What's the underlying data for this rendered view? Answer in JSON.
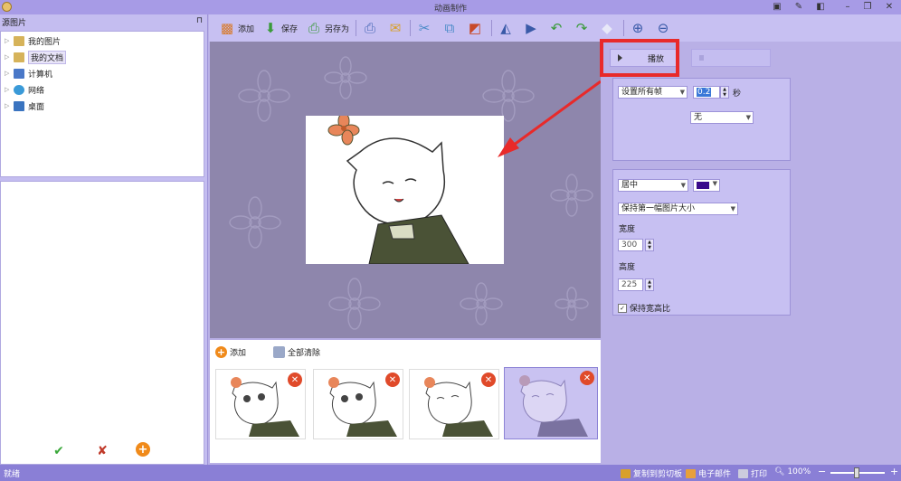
{
  "title_bar": {
    "title": "动画制作",
    "buttons": [
      "minimize",
      "restore",
      "close"
    ]
  },
  "left_panel": {
    "header": "源图片",
    "tree": [
      {
        "label": "我的图片",
        "icon": "folder-pictures-icon",
        "color": "#d6b35a"
      },
      {
        "label": "我的文档",
        "icon": "folder-documents-icon",
        "color": "#d6b35a"
      },
      {
        "label": "计算机",
        "icon": "computer-icon",
        "color": "#4a78c8"
      },
      {
        "label": "网络",
        "icon": "network-icon",
        "color": "#3a9ad8"
      },
      {
        "label": "桌面",
        "icon": "desktop-icon",
        "color": "#3a74c0"
      }
    ],
    "bottom_icons": [
      "check-icon",
      "uncheck-icon",
      "add-icon"
    ]
  },
  "toolbar": {
    "add_label": "添加",
    "save_label": "保存",
    "save_as_label": "另存为"
  },
  "filmstrip": {
    "add_label": "添加",
    "clear_all_label": "全部清除",
    "frames": 4,
    "selected_index": 3
  },
  "right_panel": {
    "play_label": "播放",
    "set_all_frames": "设置所有帧",
    "frame_delay": "0.2",
    "seconds_unit": "秒",
    "transition": "无",
    "alignment": "居中",
    "bg_color": "#3a0a8c",
    "size_mode": "保持第一幅图片大小",
    "width_label": "宽度",
    "width_value": "300",
    "height_label": "高度",
    "height_value": "225",
    "keep_ratio_label": "保持宽高比",
    "keep_ratio_checked": true
  },
  "status_bar": {
    "status": "就绪",
    "copy_clipboard": "复制到剪切板",
    "email": "电子邮件",
    "print": "打印",
    "zoom": "100%"
  },
  "colors": {
    "accent": "#8a7fd6",
    "highlight_red": "#e82a2a"
  }
}
